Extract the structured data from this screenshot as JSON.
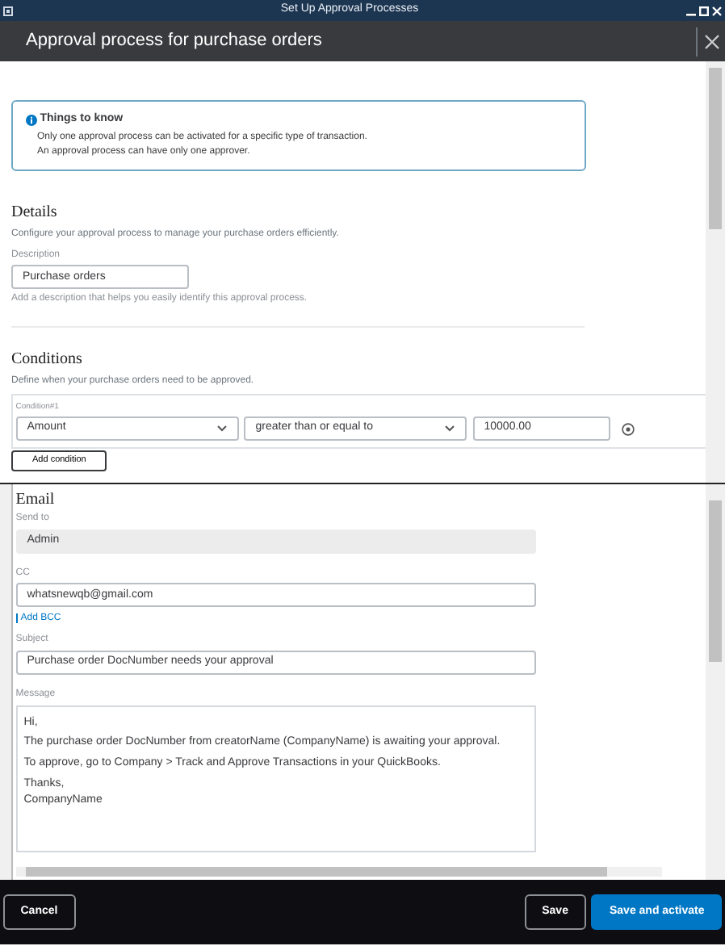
{
  "window": {
    "title": "Set Up Approval Processes"
  },
  "dialog": {
    "title": "Approval process for purchase orders"
  },
  "info": {
    "title": "Things to know",
    "bullets": [
      "Only one approval process can be activated for a specific type of transaction.",
      "An approval process can have only one approver."
    ]
  },
  "details": {
    "heading": "Details",
    "subtitle": "Configure your approval process to manage your purchase orders efficiently.",
    "description_label": "Description",
    "description_value": "Purchase orders",
    "description_help": "Add a description that helps you easily identify this approval process."
  },
  "conditions": {
    "heading": "Conditions",
    "subtitle": "Define when your purchase orders need to be approved.",
    "items": [
      {
        "label": "Condition#1",
        "field": "Amount",
        "operator": "greater than or equal to",
        "value": "10000.00"
      }
    ],
    "add_button": "Add condition"
  },
  "email": {
    "heading": "Email",
    "send_to": {
      "label": "Send to",
      "value": "Admin",
      "disabled": true
    },
    "cc": {
      "label": "CC",
      "value": "whatsnewqb@gmail.com",
      "disabled": false
    },
    "add_bcc": "Add BCC",
    "subject": {
      "label": "Subject",
      "value": "Purchase order DocNumber needs your approval",
      "disabled": false
    },
    "message_label": "Message",
    "message_paragraphs": [
      [
        "Hi,"
      ],
      [
        "The purchase order DocNumber from creatorName (CompanyName) is awaiting your approval."
      ],
      [
        "To approve, go to Company > Track and Approve Transactions in your QuickBooks."
      ],
      [
        "Thanks,",
        "CompanyName"
      ]
    ]
  },
  "footer": {
    "buttons": [
      {
        "label": "Cancel",
        "kind": "secondary"
      },
      {
        "label": "Save",
        "kind": "secondary"
      },
      {
        "label": "Save and activate",
        "kind": "primary"
      }
    ]
  }
}
